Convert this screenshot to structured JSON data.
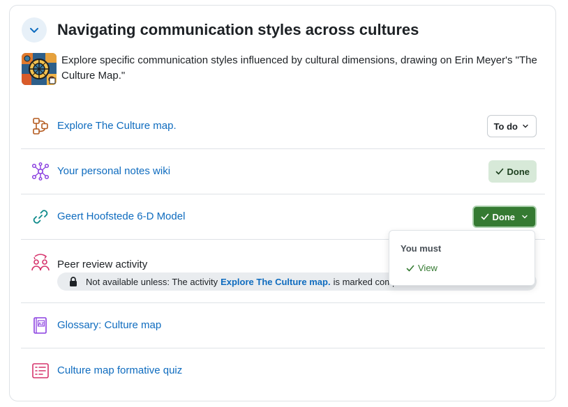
{
  "section": {
    "title": "Navigating communication styles across cultures",
    "summary": "Explore specific communication styles influenced by cultural dimensions, drawing on Erin Meyer's \"The Culture Map.\""
  },
  "activities": [
    {
      "name": "Explore The Culture map.",
      "icon": "flow-diagram-icon",
      "status": "To do"
    },
    {
      "name": "Your personal notes wiki",
      "icon": "network-nodes-icon",
      "status": "Done"
    },
    {
      "name": "Geert Hoofstede 6-D Model",
      "icon": "link-icon",
      "status": "Done"
    },
    {
      "name": "Peer review activity",
      "icon": "peer-review-icon",
      "restriction": {
        "prefix": "Not available unless: The activity",
        "activity": "Explore The Culture map.",
        "suffix": "is marked complete"
      }
    },
    {
      "name": "Glossary: Culture map",
      "icon": "glossary-book-icon"
    },
    {
      "name": "Culture map formative quiz",
      "icon": "quiz-icon"
    }
  ],
  "completion_dropdown": {
    "header": "You must",
    "items": [
      "View"
    ]
  },
  "colors": {
    "link": "#0f6cbf",
    "done_dark": "#357a32",
    "done_light": "#d7e9d8",
    "accent_light": "#e7f0f8"
  }
}
